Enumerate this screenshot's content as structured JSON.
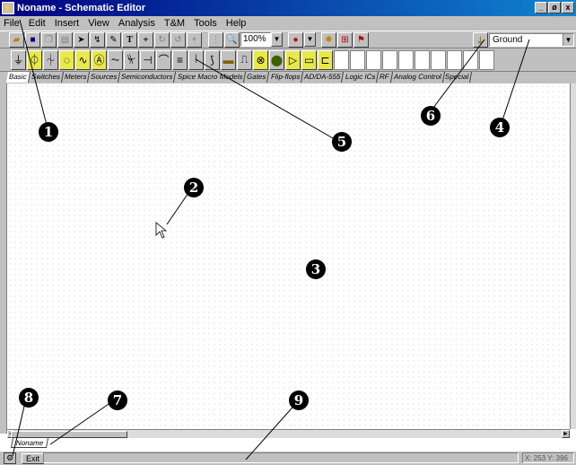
{
  "window": {
    "title": "Noname - Schematic Editor",
    "controls": [
      "_",
      "ø",
      "x"
    ]
  },
  "menu": [
    "File",
    "Edit",
    "Insert",
    "View",
    "Analysis",
    "T&M",
    "Tools",
    "Help"
  ],
  "toolbar": {
    "zoom_value": "100%",
    "ground_value": "Ground"
  },
  "tabs": [
    "Basic",
    "Switches",
    "Meters",
    "Sources",
    "Semiconductors",
    "Spice Macro Models",
    "Gates",
    "Flip-flops",
    "AD/DA-555",
    "Logic ICs",
    "RF",
    "Analog Control",
    "Special"
  ],
  "sheet_tab": "Noname",
  "status": {
    "exit_label": "Exit",
    "coords": "X: 253 Y: 396"
  },
  "callouts": [
    "1",
    "2",
    "3",
    "4",
    "5",
    "6",
    "7",
    "8",
    "9"
  ]
}
